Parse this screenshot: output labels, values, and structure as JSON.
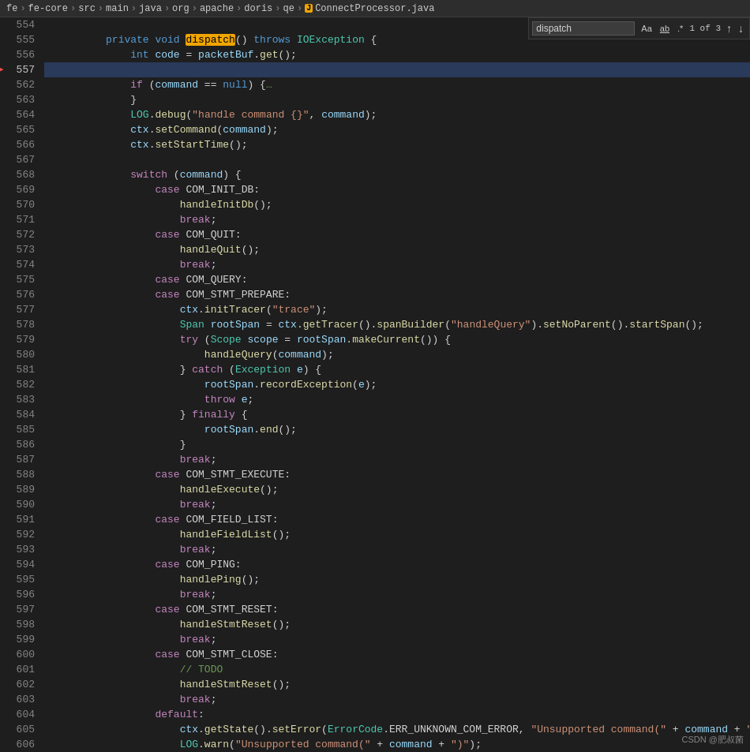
{
  "breadcrumb": {
    "items": [
      "fe",
      "fe-core",
      "src",
      "main",
      "java",
      "org",
      "apache",
      "doris",
      "qe"
    ],
    "file_icon": "J",
    "file_name": "ConnectProcessor.java"
  },
  "search": {
    "query": "dispatch",
    "match_case_label": "Aa",
    "match_whole_word_label": "ab",
    "use_regex_label": ".*",
    "count_text": "1 of 3",
    "up_arrow": "↑",
    "down_arrow": "↓"
  },
  "lines": [
    {
      "num": 554,
      "active": false,
      "highlighted": false,
      "arrow": false
    },
    {
      "num": 555,
      "active": false,
      "highlighted": false,
      "arrow": false
    },
    {
      "num": 556,
      "active": false,
      "highlighted": false,
      "arrow": false
    },
    {
      "num": 557,
      "active": true,
      "highlighted": true,
      "arrow": true
    },
    {
      "num": 562,
      "active": false,
      "highlighted": false,
      "arrow": false
    },
    {
      "num": 563,
      "active": false,
      "highlighted": false,
      "arrow": false
    },
    {
      "num": 564,
      "active": false,
      "highlighted": false,
      "arrow": false
    },
    {
      "num": 565,
      "active": false,
      "highlighted": false,
      "arrow": false
    },
    {
      "num": 566,
      "active": false,
      "highlighted": false,
      "arrow": false
    },
    {
      "num": 567,
      "active": false,
      "highlighted": false,
      "arrow": false
    },
    {
      "num": 568,
      "active": false,
      "highlighted": false,
      "arrow": false
    },
    {
      "num": 569,
      "active": false,
      "highlighted": false,
      "arrow": false
    },
    {
      "num": 570,
      "active": false,
      "highlighted": false,
      "arrow": false
    },
    {
      "num": 571,
      "active": false,
      "highlighted": false,
      "arrow": false
    },
    {
      "num": 572,
      "active": false,
      "highlighted": false,
      "arrow": false
    },
    {
      "num": 573,
      "active": false,
      "highlighted": false,
      "arrow": false
    },
    {
      "num": 574,
      "active": false,
      "highlighted": false,
      "arrow": false
    },
    {
      "num": 575,
      "active": false,
      "highlighted": false,
      "arrow": false
    },
    {
      "num": 576,
      "active": false,
      "highlighted": false,
      "arrow": false
    },
    {
      "num": 577,
      "active": false,
      "highlighted": false,
      "arrow": false
    },
    {
      "num": 578,
      "active": false,
      "highlighted": false,
      "arrow": false
    },
    {
      "num": 579,
      "active": false,
      "highlighted": false,
      "arrow": false
    },
    {
      "num": 580,
      "active": false,
      "highlighted": false,
      "arrow": false
    },
    {
      "num": 581,
      "active": false,
      "highlighted": false,
      "arrow": false
    },
    {
      "num": 582,
      "active": false,
      "highlighted": false,
      "arrow": false
    },
    {
      "num": 583,
      "active": false,
      "highlighted": false,
      "arrow": false
    },
    {
      "num": 584,
      "active": false,
      "highlighted": false,
      "arrow": false
    },
    {
      "num": 585,
      "active": false,
      "highlighted": false,
      "arrow": false
    },
    {
      "num": 586,
      "active": false,
      "highlighted": false,
      "arrow": false
    },
    {
      "num": 587,
      "active": false,
      "highlighted": false,
      "arrow": false
    },
    {
      "num": 588,
      "active": false,
      "highlighted": false,
      "arrow": false
    },
    {
      "num": 589,
      "active": false,
      "highlighted": false,
      "arrow": false
    },
    {
      "num": 590,
      "active": false,
      "highlighted": false,
      "arrow": false
    },
    {
      "num": 591,
      "active": false,
      "highlighted": false,
      "arrow": false
    },
    {
      "num": 592,
      "active": false,
      "highlighted": false,
      "arrow": false
    },
    {
      "num": 593,
      "active": false,
      "highlighted": false,
      "arrow": false
    },
    {
      "num": 594,
      "active": false,
      "highlighted": false,
      "arrow": false
    },
    {
      "num": 595,
      "active": false,
      "highlighted": false,
      "arrow": false
    },
    {
      "num": 596,
      "active": false,
      "highlighted": false,
      "arrow": false
    },
    {
      "num": 597,
      "active": false,
      "highlighted": false,
      "arrow": false
    },
    {
      "num": 598,
      "active": false,
      "highlighted": false,
      "arrow": false
    },
    {
      "num": 599,
      "active": false,
      "highlighted": false,
      "arrow": false
    },
    {
      "num": 600,
      "active": false,
      "highlighted": false,
      "arrow": false
    },
    {
      "num": 601,
      "active": false,
      "highlighted": false,
      "arrow": false
    },
    {
      "num": 602,
      "active": false,
      "highlighted": false,
      "arrow": false
    },
    {
      "num": 603,
      "active": false,
      "highlighted": false,
      "arrow": false
    },
    {
      "num": 604,
      "active": false,
      "highlighted": false,
      "arrow": false
    },
    {
      "num": 605,
      "active": false,
      "highlighted": false,
      "arrow": false
    },
    {
      "num": 606,
      "active": false,
      "highlighted": false,
      "arrow": false
    }
  ],
  "watermark": "CSDN @肥叔菌"
}
